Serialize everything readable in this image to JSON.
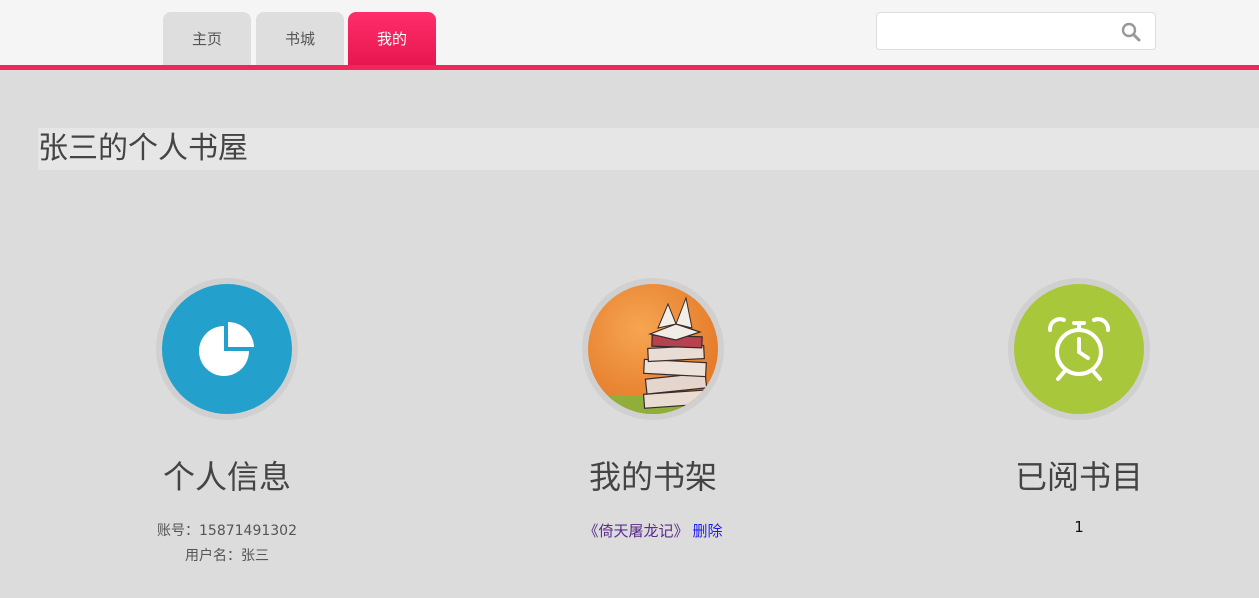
{
  "nav": {
    "tabs": [
      {
        "label": "主页"
      },
      {
        "label": "书城"
      },
      {
        "label": "我的",
        "active": true
      }
    ]
  },
  "search": {
    "value": "",
    "placeholder": ""
  },
  "page": {
    "title": "张三的个人书屋"
  },
  "sections": {
    "profile": {
      "title": "个人信息",
      "account_line": "账号：15871491302",
      "username_line": "用户名：张三",
      "icon": "pie-chart-icon"
    },
    "bookshelf": {
      "title": "我的书架",
      "book": "《倚天屠龙记》",
      "delete_label": "删除",
      "icon": "book-stack-icon"
    },
    "read": {
      "title": "已阅书目",
      "count": "1",
      "icon": "alarm-clock-icon"
    }
  },
  "colors": {
    "accent": "#f0285a",
    "profile_circle": "#23a0cc",
    "read_circle": "#a8c73b"
  }
}
